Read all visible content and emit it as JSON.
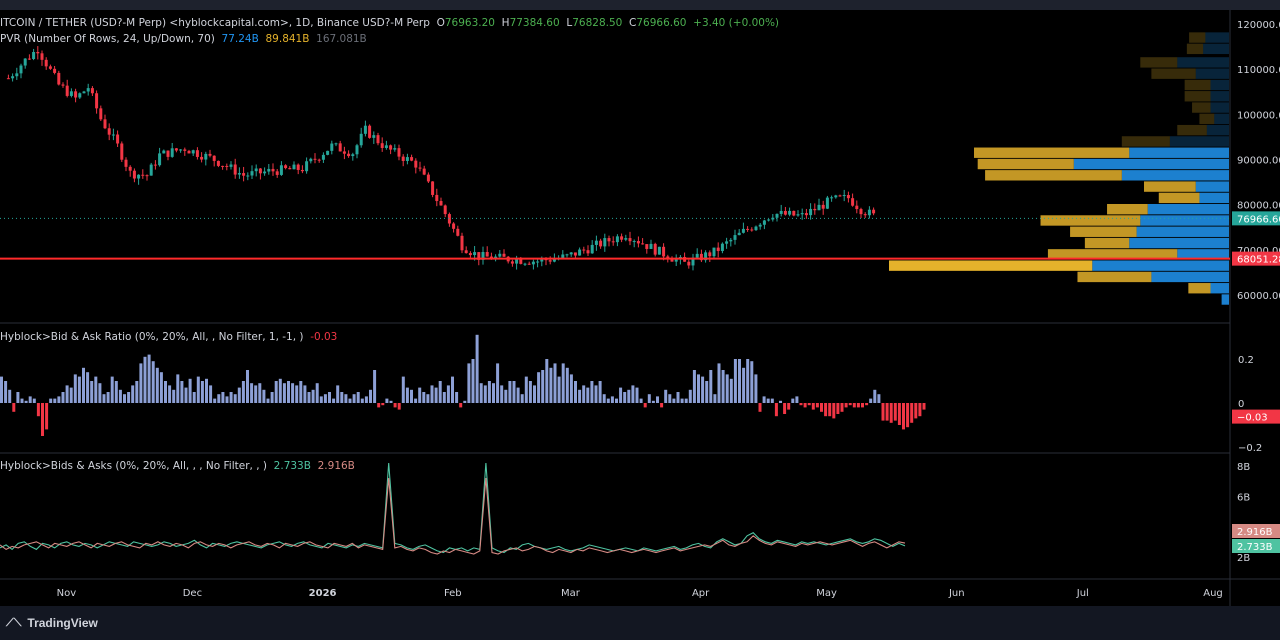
{
  "header": {
    "symbol": "ITCOIN / TETHER (USD?-M Perp) <hyblockcapital.com>, 1D, Binance USD?-M Perp",
    "o_label": "O",
    "o_value": "76963.20",
    "h_label": "H",
    "h_value": "77384.60",
    "l_label": "L",
    "l_value": "76828.50",
    "c_label": "C",
    "c_value": "76966.60",
    "change": "+3.40 (+0.00%)"
  },
  "vpvr": {
    "title": "PVR (Number Of Rows, 24, Up/Down, 70)",
    "up_volume": "77.24B",
    "down_volume": "89.841B",
    "total_volume": "167.081B"
  },
  "indicator1": {
    "title": "Hyblock>Bid & Ask Ratio (0%, 20%, All, , No Filter, 1, -1, )",
    "value": "-0.03"
  },
  "indicator2": {
    "title": "Hyblock>Bids & Asks (0%, 20%, All, , , No Filter, , )",
    "bids": "2.733B",
    "asks": "2.916B"
  },
  "badges": {
    "last_price": "76966.60",
    "poc_price": "68051.28",
    "ratio_last": "−0.03",
    "asks_last": "2.916B",
    "bids_last": "2.733B"
  },
  "brand": {
    "name": "TradingView"
  },
  "colors": {
    "up": "#26a69a",
    "down": "#f23645",
    "vp_up": "#2196f3",
    "vp_down": "#e5b22b",
    "ratio_pos": "#8da0d6",
    "bids_line": "#4fc3a1",
    "asks_line": "#d68a84"
  },
  "chart_data": [
    {
      "type": "candlestick",
      "title": "",
      "y_axis_ticks": [
        "120000.00",
        "110000.00",
        "100000.00",
        "90000.00",
        "80000.00",
        "70000.00",
        "60000.00"
      ],
      "ylim": [
        54000,
        122000
      ],
      "x_ticks": [
        "Nov",
        "Dec",
        "2026",
        "Feb",
        "Mar",
        "Apr",
        "May",
        "Jun",
        "Jul",
        "Aug"
      ],
      "poc_line": 68051.28,
      "last_price": 76966.6,
      "approx_close_path": [
        {
          "date": "2025-10-22",
          "close": 108000
        },
        {
          "date": "2025-10-26",
          "close": 112000
        },
        {
          "date": "2025-10-29",
          "close": 114500
        },
        {
          "date": "2025-11-03",
          "close": 106500
        },
        {
          "date": "2025-11-07",
          "close": 103500
        },
        {
          "date": "2025-11-10",
          "close": 106000
        },
        {
          "date": "2025-11-13",
          "close": 99000
        },
        {
          "date": "2025-11-17",
          "close": 93000
        },
        {
          "date": "2025-11-20",
          "close": 87000
        },
        {
          "date": "2025-11-24",
          "close": 86500
        },
        {
          "date": "2025-11-27",
          "close": 91000
        },
        {
          "date": "2025-12-03",
          "close": 92500
        },
        {
          "date": "2025-12-10",
          "close": 90000
        },
        {
          "date": "2025-12-17",
          "close": 86500
        },
        {
          "date": "2025-12-24",
          "close": 87500
        },
        {
          "date": "2025-12-31",
          "close": 88000
        },
        {
          "date": "2026-01-07",
          "close": 93000
        },
        {
          "date": "2026-01-12",
          "close": 91500
        },
        {
          "date": "2026-01-15",
          "close": 96500
        },
        {
          "date": "2026-01-20",
          "close": 92500
        },
        {
          "date": "2026-01-27",
          "close": 89000
        },
        {
          "date": "2026-02-03",
          "close": 78000
        },
        {
          "date": "2026-02-07",
          "close": 71000
        },
        {
          "date": "2026-02-11",
          "close": 68500
        },
        {
          "date": "2026-02-18",
          "close": 68000
        },
        {
          "date": "2026-02-25",
          "close": 67500
        },
        {
          "date": "2026-03-04",
          "close": 68500
        },
        {
          "date": "2026-03-11",
          "close": 71000
        },
        {
          "date": "2026-03-18",
          "close": 73500
        },
        {
          "date": "2026-03-25",
          "close": 70000
        },
        {
          "date": "2026-04-01",
          "close": 67000
        },
        {
          "date": "2026-04-08",
          "close": 69500
        },
        {
          "date": "2026-04-15",
          "close": 74000
        },
        {
          "date": "2026-04-22",
          "close": 78000
        },
        {
          "date": "2026-04-29",
          "close": 77500
        },
        {
          "date": "2026-05-06",
          "close": 81000
        },
        {
          "date": "2026-05-10",
          "close": 81500
        },
        {
          "date": "2026-05-13",
          "close": 79000
        },
        {
          "date": "2026-05-17",
          "close": 77000
        }
      ],
      "volume_profile": {
        "rows": [
          {
            "price": 117000,
            "up": 3.2,
            "down": 2.2
          },
          {
            "price": 114500,
            "up": 3.5,
            "down": 2.2
          },
          {
            "price": 111500,
            "up": 7.0,
            "down": 5.0
          },
          {
            "price": 109000,
            "up": 4.5,
            "down": 6.0
          },
          {
            "price": 106500,
            "up": 2.5,
            "down": 3.5
          },
          {
            "price": 104000,
            "up": 2.5,
            "down": 3.5
          },
          {
            "price": 101500,
            "up": 2.5,
            "down": 2.5
          },
          {
            "price": 99000,
            "up": 2.0,
            "down": 2.0
          },
          {
            "price": 96500,
            "up": 3.0,
            "down": 4.0
          },
          {
            "price": 94000,
            "up": 8.0,
            "down": 6.5
          },
          {
            "price": 91500,
            "up": 13.5,
            "down": 21.0
          },
          {
            "price": 89000,
            "up": 21.0,
            "down": 13.0
          },
          {
            "price": 86500,
            "up": 14.5,
            "down": 18.5
          },
          {
            "price": 84000,
            "up": 4.5,
            "down": 7.0
          },
          {
            "price": 81500,
            "up": 4.0,
            "down": 5.5
          },
          {
            "price": 79000,
            "up": 11.0,
            "down": 5.5
          },
          {
            "price": 76500,
            "up": 12.0,
            "down": 13.5
          },
          {
            "price": 74000,
            "up": 12.5,
            "down": 9.0
          },
          {
            "price": 71500,
            "up": 13.5,
            "down": 6.0
          },
          {
            "price": 69000,
            "up": 7.0,
            "down": 17.5
          },
          {
            "price": 66500,
            "up": 18.5,
            "down": 27.5
          },
          {
            "price": 64000,
            "up": 10.5,
            "down": 10.0
          },
          {
            "price": 61500,
            "up": 2.5,
            "down": 3.0
          },
          {
            "price": 59000,
            "up": 1.0,
            "down": 0.0
          }
        ]
      }
    },
    {
      "type": "bar",
      "title": "Hyblock>Bid & Ask Ratio",
      "y_axis_ticks": [
        "0.2",
        "0",
        "−0.2"
      ],
      "ylim": [
        -0.23,
        0.33
      ],
      "values": [
        0.12,
        0.1,
        0.06,
        -0.04,
        0.05,
        0.02,
        0.01,
        0.03,
        0.02,
        -0.06,
        -0.15,
        -0.12,
        0.02,
        0.02,
        0.03,
        0.05,
        0.08,
        0.07,
        0.13,
        0.12,
        0.16,
        0.14,
        0.1,
        0.12,
        0.09,
        0.04,
        0.05,
        0.12,
        0.1,
        0.06,
        0.04,
        0.05,
        0.08,
        0.1,
        0.18,
        0.21,
        0.22,
        0.19,
        0.16,
        0.14,
        0.1,
        0.08,
        0.06,
        0.13,
        0.1,
        0.07,
        0.11,
        0.05,
        0.12,
        0.1,
        0.11,
        0.08,
        0.02,
        0.04,
        0.05,
        0.03,
        0.05,
        0.04,
        0.07,
        0.1,
        0.15,
        0.09,
        0.08,
        0.09,
        0.06,
        0.02,
        0.05,
        0.1,
        0.11,
        0.09,
        0.1,
        0.09,
        0.08,
        0.1,
        0.08,
        0.05,
        0.06,
        0.09,
        0.03,
        0.04,
        0.05,
        0.02,
        0.08,
        0.05,
        0.04,
        0.02,
        0.04,
        0.05,
        0.02,
        0.03,
        0.06,
        0.15,
        -0.02,
        -0.01,
        0.02,
        0.01,
        -0.02,
        -0.03,
        0.12,
        0.07,
        0.06,
        0.02,
        0.07,
        0.05,
        0.04,
        0.08,
        0.07,
        0.1,
        0.05,
        0.08,
        0.12,
        0.05,
        -0.02,
        0.01,
        0.18,
        0.2,
        0.31,
        0.09,
        0.08,
        0.1,
        0.09,
        0.18,
        0.08,
        0.06,
        0.1,
        0.1,
        0.07,
        0.04,
        0.12,
        0.1,
        0.08,
        0.14,
        0.15,
        0.2,
        0.16,
        0.18,
        0.12,
        0.18,
        0.16,
        0.13,
        0.1,
        0.06,
        0.08,
        0.07,
        0.1,
        0.08,
        0.1,
        0.04,
        0.02,
        0.03,
        0.02,
        0.07,
        0.05,
        0.06,
        0.08,
        0.07,
        0.02,
        -0.02,
        0.04,
        0.01,
        0.03,
        -0.02,
        0.06,
        0.04,
        0.02,
        0.05,
        0.02,
        0.02,
        0.06,
        0.15,
        0.13,
        0.12,
        0.1,
        0.15,
        0.04,
        0.18,
        0.15,
        0.13,
        0.11,
        0.2,
        0.2,
        0.16,
        0.2,
        0.19,
        0.13,
        -0.04,
        0.03,
        0.02,
        0.02,
        -0.06,
        0.01,
        -0.05,
        -0.03,
        0.02,
        0.03,
        -0.01,
        -0.02,
        -0.01,
        -0.03,
        -0.02,
        -0.04,
        -0.06,
        -0.06,
        -0.07,
        -0.05,
        -0.04,
        -0.02,
        -0.01,
        -0.02,
        -0.02,
        -0.02,
        -0.01,
        0.02,
        0.06,
        0.04,
        -0.08,
        -0.08,
        -0.09,
        -0.08,
        -0.1,
        -0.12,
        -0.11,
        -0.09,
        -0.07,
        -0.06,
        -0.03
      ]
    },
    {
      "type": "line",
      "title": "Hyblock>Bids & Asks",
      "y_axis_ticks": [
        "8B",
        "6B",
        "2B"
      ],
      "ylim": [
        0.6,
        8.2
      ],
      "series": [
        {
          "name": "Bids",
          "last": "2.733B",
          "values": [
            2.6,
            2.8,
            2.5,
            2.9,
            3.0,
            2.7,
            2.5,
            2.9,
            2.8,
            2.6,
            2.9,
            3.0,
            2.8,
            2.7,
            2.9,
            2.8,
            2.6,
            2.8,
            3.0,
            2.9,
            2.8,
            2.7,
            3.0,
            2.9,
            2.8,
            2.7,
            2.8,
            3.0,
            2.9,
            2.7,
            2.8,
            2.9,
            3.1,
            2.8,
            2.6,
            2.9,
            2.8,
            2.7,
            2.9,
            3.0,
            2.9,
            2.8,
            2.7,
            2.6,
            2.8,
            2.9,
            3.0,
            2.8,
            2.7,
            2.9,
            3.0,
            2.8,
            2.7,
            2.6,
            2.9,
            2.8,
            2.7,
            2.6,
            2.8,
            2.7,
            2.9,
            2.8,
            2.7,
            2.6,
            8.2,
            2.9,
            2.8,
            2.6,
            2.5,
            2.7,
            2.8,
            2.6,
            2.4,
            2.3,
            2.6,
            2.5,
            2.6,
            2.4,
            2.6,
            2.5,
            8.2,
            2.6,
            2.4,
            2.3,
            2.6,
            2.5,
            2.8,
            2.9,
            2.7,
            2.6,
            2.5,
            2.6,
            2.7,
            2.5,
            2.4,
            2.5,
            2.6,
            2.8,
            2.7,
            2.6,
            2.5,
            2.4,
            2.5,
            2.6,
            2.5,
            2.4,
            2.6,
            2.5,
            2.4,
            2.5,
            2.6,
            2.7,
            2.5,
            2.6,
            2.8,
            2.9,
            2.7,
            2.6,
            3.0,
            3.2,
            3.0,
            2.8,
            2.9,
            3.4,
            3.6,
            3.2,
            3.0,
            2.9,
            3.1,
            3.0,
            2.9,
            2.8,
            3.0,
            2.9,
            3.0,
            2.9,
            2.8,
            2.9,
            3.0,
            3.1,
            3.2,
            3.0,
            2.9,
            3.0,
            3.2,
            3.1,
            2.9,
            2.7,
            2.9,
            2.733
          ]
        },
        {
          "name": "Asks",
          "last": "2.916B",
          "values": [
            2.8,
            2.5,
            2.7,
            2.6,
            2.8,
            2.9,
            3.0,
            2.8,
            2.6,
            2.9,
            2.8,
            2.7,
            2.9,
            3.0,
            2.8,
            2.6,
            2.9,
            2.8,
            2.7,
            2.9,
            3.0,
            2.8,
            2.7,
            2.6,
            2.9,
            2.8,
            3.0,
            2.8,
            2.7,
            2.9,
            2.8,
            2.6,
            2.9,
            3.0,
            2.8,
            2.7,
            2.9,
            2.8,
            2.6,
            2.8,
            2.9,
            3.0,
            2.8,
            2.7,
            2.9,
            2.8,
            2.6,
            2.9,
            2.8,
            2.7,
            2.9,
            3.0,
            2.8,
            2.7,
            2.6,
            2.9,
            2.8,
            2.7,
            2.9,
            2.6,
            2.8,
            2.7,
            2.6,
            2.5,
            7.2,
            2.6,
            2.7,
            2.5,
            2.4,
            2.6,
            2.5,
            2.3,
            2.2,
            2.4,
            2.3,
            2.5,
            2.4,
            2.3,
            2.2,
            2.4,
            7.2,
            2.3,
            2.2,
            2.4,
            2.5,
            2.6,
            2.4,
            2.5,
            2.7,
            2.6,
            2.4,
            2.3,
            2.5,
            2.4,
            2.3,
            2.5,
            2.4,
            2.6,
            2.5,
            2.4,
            2.3,
            2.4,
            2.5,
            2.4,
            2.3,
            2.4,
            2.5,
            2.4,
            2.3,
            2.4,
            2.5,
            2.6,
            2.4,
            2.5,
            2.6,
            2.7,
            2.8,
            2.7,
            2.9,
            3.1,
            2.8,
            2.7,
            2.9,
            3.0,
            3.4,
            3.1,
            2.9,
            2.8,
            3.0,
            2.9,
            2.8,
            2.7,
            2.9,
            2.8,
            2.9,
            3.0,
            2.9,
            2.8,
            2.9,
            3.0,
            3.1,
            2.9,
            2.7,
            2.9,
            3.0,
            2.8,
            2.6,
            2.8,
            3.0,
            2.916
          ]
        }
      ]
    }
  ]
}
